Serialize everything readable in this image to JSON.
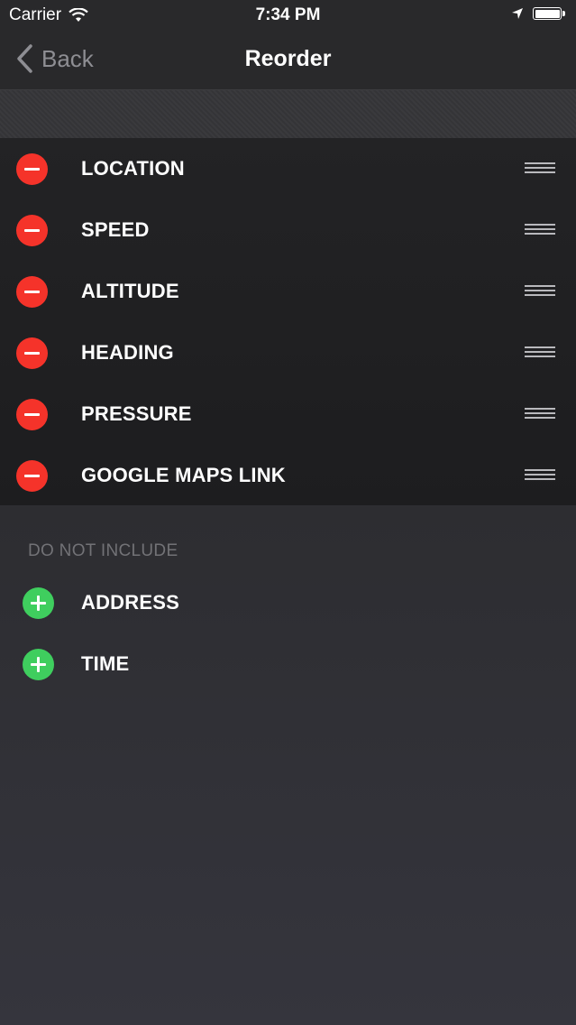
{
  "status_bar": {
    "carrier": "Carrier",
    "time": "7:34 PM",
    "icons": [
      "wifi-icon",
      "location-arrow-icon",
      "battery-icon"
    ]
  },
  "nav": {
    "back_label": "Back",
    "title": "Reorder"
  },
  "included": {
    "items": [
      {
        "label": "LOCATION"
      },
      {
        "label": "SPEED"
      },
      {
        "label": "ALTITUDE"
      },
      {
        "label": "HEADING"
      },
      {
        "label": "PRESSURE"
      },
      {
        "label": "GOOGLE MAPS LINK"
      }
    ]
  },
  "excluded": {
    "header": "DO NOT INCLUDE",
    "items": [
      {
        "label": "ADDRESS"
      },
      {
        "label": "TIME"
      }
    ]
  },
  "colors": {
    "remove": "#f5332a",
    "add": "#3fce5e",
    "background": "#2d2d31"
  }
}
